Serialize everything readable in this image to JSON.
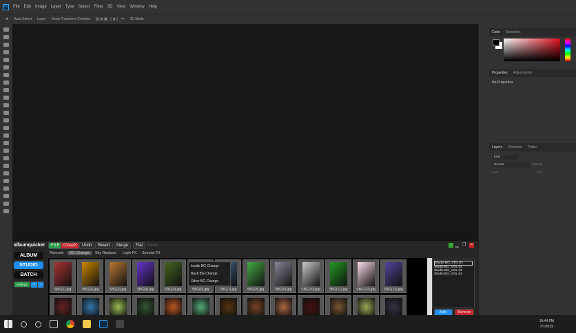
{
  "menu": {
    "logo": "Ps",
    "items": [
      "File",
      "Edit",
      "Image",
      "Layer",
      "Type",
      "Select",
      "Filter",
      "3D",
      "View",
      "Window",
      "Help"
    ]
  },
  "options": {
    "auto_select": "Auto-Select",
    "layer_select": "Layer",
    "transform": "Show Transform Controls",
    "mode": "3D Mode"
  },
  "panels": {
    "color_tabs": [
      "Color",
      "Swatches"
    ],
    "props_tabs": [
      "Properties",
      "Adjustments"
    ],
    "no_props": "No Properties",
    "layer_tabs": [
      "Layers",
      "Channels",
      "Paths"
    ],
    "kind": "Kind",
    "blend": "Normal",
    "opacity": "Opacity:",
    "lock": "Lock:",
    "fill": "Fill:"
  },
  "plugin": {
    "brand": "albumquicker",
    "top_buttons": [
      "FILE",
      "CloseX",
      "Undo",
      "Revert",
      "Merge",
      "Flat",
      "Demo"
    ],
    "side_buttons": [
      "ALBUM",
      "STUDIO",
      "BATCH"
    ],
    "settings": "settings",
    "plus": "+",
    "minus": "-",
    "subtabs": [
      "Retouch",
      "BG Change",
      "Sky Replace",
      "Light FX",
      "Special FX"
    ],
    "thumbs_row1": [
      "SBG(1).jpg",
      "SBG(2).jpg",
      "SBG(3).jpg",
      "SBG(4).jpg",
      "SBG(5).jpg",
      "SBG(6).jpg",
      "SBG(7).jpg",
      "SBG(8).jpg",
      "SBG(9).jpg",
      "SBG(10).jpg",
      "SBG(11).jpg",
      "SBG(12).jpg",
      "SBG(13).jpg"
    ],
    "thumb_colors1": [
      "#a33",
      "#c80",
      "#b73",
      "#63c",
      "#462",
      "#333",
      "#468",
      "#4a4",
      "#889",
      "#ccc",
      "#292",
      "#fde",
      "#549"
    ],
    "thumb_colors2": [
      "#622",
      "#37a",
      "#9b5",
      "#353",
      "#b52",
      "#5a7",
      "#531",
      "#742",
      "#a64",
      "#411",
      "#753",
      "#9a5",
      "#334"
    ],
    "context_menu": [
      "Inside BG Change",
      "Back BG Change",
      "Other BG Change"
    ],
    "list": [
      "Studio BG_VOL.01",
      "Studio BG_VOL.02",
      "Studio BG_VOL.03",
      "Studio BG_VOL.04"
    ],
    "add": "Add+",
    "remove": "Remove"
  },
  "taskbar": {
    "time": "10:44 PM",
    "date": "7/7/2019"
  }
}
